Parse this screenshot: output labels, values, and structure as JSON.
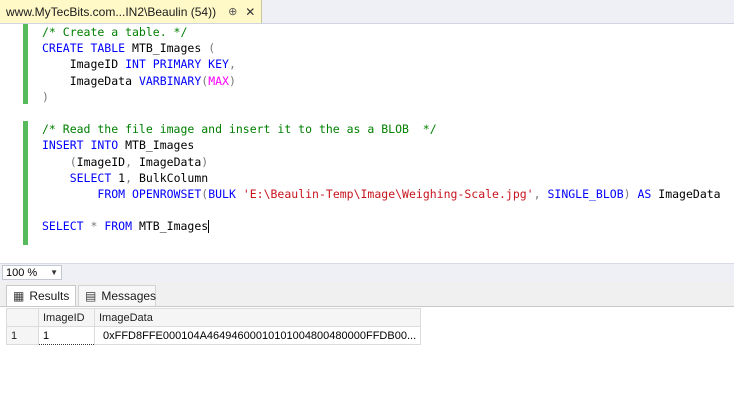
{
  "tab": {
    "title": "www.MyTecBits.com...IN2\\Beaulin (54))",
    "pin_glyph": "⊕",
    "close_glyph": "✕"
  },
  "editor": {
    "lines": [
      [
        {
          "t": "/* Create a table. */",
          "c": "cm"
        }
      ],
      [
        {
          "t": "CREATE TABLE",
          "c": "kw"
        },
        {
          "t": " MTB_Images ",
          "c": ""
        },
        {
          "t": "(",
          "c": "gy"
        }
      ],
      [
        {
          "t": "    ImageID ",
          "c": ""
        },
        {
          "t": "INT PRIMARY KEY",
          "c": "kw"
        },
        {
          "t": ",",
          "c": "gy"
        }
      ],
      [
        {
          "t": "    ImageData ",
          "c": ""
        },
        {
          "t": "VARBINARY",
          "c": "kw"
        },
        {
          "t": "(",
          "c": "gy"
        },
        {
          "t": "MAX",
          "c": "fn"
        },
        {
          "t": ")",
          "c": "gy"
        }
      ],
      [
        {
          "t": ")",
          "c": "gy"
        }
      ],
      [],
      [
        {
          "t": "/* Read the file image and insert it to the as a BLOB  */",
          "c": "cm"
        }
      ],
      [
        {
          "t": "INSERT INTO",
          "c": "kw"
        },
        {
          "t": " MTB_Images",
          "c": ""
        }
      ],
      [
        {
          "t": "    ",
          "c": ""
        },
        {
          "t": "(",
          "c": "gy"
        },
        {
          "t": "ImageID",
          "c": ""
        },
        {
          "t": ",",
          "c": "gy"
        },
        {
          "t": " ImageData",
          "c": ""
        },
        {
          "t": ")",
          "c": "gy"
        }
      ],
      [
        {
          "t": "    ",
          "c": ""
        },
        {
          "t": "SELECT",
          "c": "kw"
        },
        {
          "t": " 1",
          "c": ""
        },
        {
          "t": ",",
          "c": "gy"
        },
        {
          "t": " BulkColumn",
          "c": ""
        }
      ],
      [
        {
          "t": "        ",
          "c": ""
        },
        {
          "t": "FROM OPENROWSET",
          "c": "kw"
        },
        {
          "t": "(",
          "c": "gy"
        },
        {
          "t": "BULK ",
          "c": "kw"
        },
        {
          "t": "'E:\\Beaulin-Temp\\Image\\Weighing-Scale.jpg'",
          "c": "st"
        },
        {
          "t": ",",
          "c": "gy"
        },
        {
          "t": " SINGLE_BLOB",
          "c": "kw"
        },
        {
          "t": ")",
          "c": "gy"
        },
        {
          "t": " AS",
          "c": "kw"
        },
        {
          "t": " ImageData",
          "c": ""
        }
      ],
      [],
      [
        {
          "t": "SELECT",
          "c": "kw"
        },
        {
          "t": " * ",
          "c": "gy"
        },
        {
          "t": "FROM",
          "c": "kw"
        },
        {
          "t": " MTB_Images",
          "c": ""
        }
      ]
    ]
  },
  "zoom": {
    "value": "100 %",
    "arrow_glyph": "▼"
  },
  "results": {
    "tabs": [
      {
        "label": "Results",
        "icon": "grid-icon",
        "glyph": "▦"
      },
      {
        "label": "Messages",
        "icon": "messages-icon",
        "glyph": "▤"
      }
    ],
    "columns": [
      "ImageID",
      "ImageData"
    ],
    "rows": [
      {
        "num": "1",
        "cells": [
          "1",
          "0xFFD8FFE000104A46494600010101004800480000FFDB00..."
        ]
      }
    ]
  }
}
